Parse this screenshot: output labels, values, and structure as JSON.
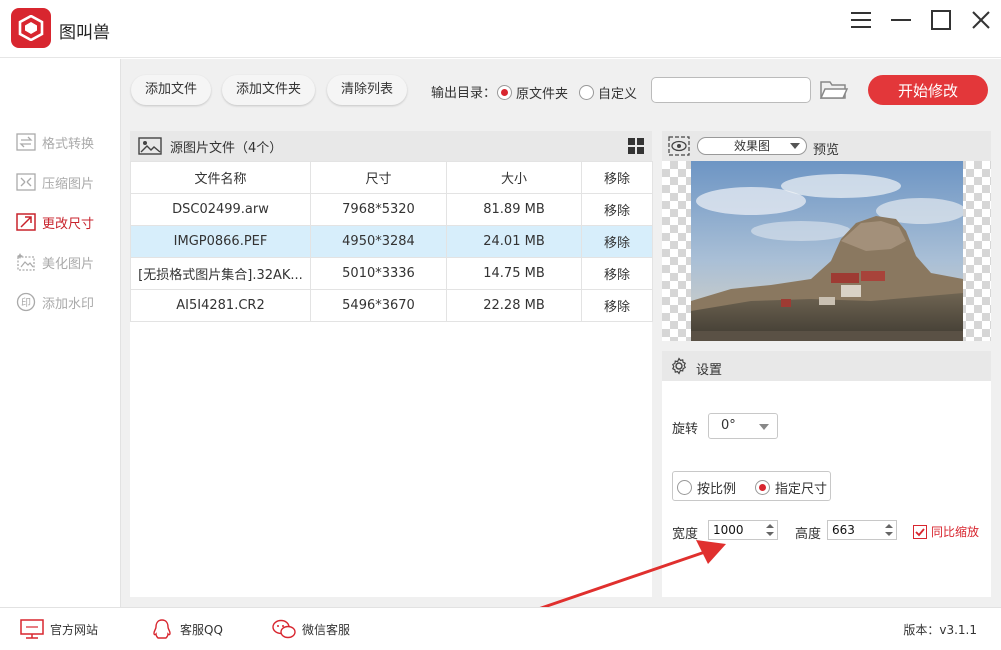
{
  "app": {
    "title": "图叫兽"
  },
  "sidebar": {
    "items": [
      {
        "label": "格式转换",
        "icon": "swap-icon",
        "active": false
      },
      {
        "label": "压缩图片",
        "icon": "compress-icon",
        "active": false
      },
      {
        "label": "更改尺寸",
        "icon": "resize-icon",
        "active": true
      },
      {
        "label": "美化图片",
        "icon": "beautify-icon",
        "active": false
      },
      {
        "label": "添加水印",
        "icon": "watermark-icon",
        "active": false
      }
    ]
  },
  "toolbar": {
    "add_file": "添加文件",
    "add_folder": "添加文件夹",
    "clear_list": "清除列表",
    "output_label": "输出目录：",
    "opt_original": "原文件夹",
    "opt_custom": "自定义",
    "path_value": "",
    "start": "开始修改"
  },
  "files": {
    "header": "源图片文件（4个）",
    "columns": [
      "文件名称",
      "尺寸",
      "大小",
      "移除"
    ],
    "rows": [
      {
        "name": "DSC02499.arw",
        "size": "7968*5320",
        "filesize": "81.89 MB",
        "remove": "移除",
        "selected": false
      },
      {
        "name": "IMGP0866.PEF",
        "size": "4950*3284",
        "filesize": "24.01 MB",
        "remove": "移除",
        "selected": true
      },
      {
        "name": "[无损格式图片集合].32AK...",
        "size": "5010*3336",
        "filesize": "14.75 MB",
        "remove": "移除",
        "selected": false
      },
      {
        "name": "AI5I4281.CR2",
        "size": "5496*3670",
        "filesize": "22.28 MB",
        "remove": "移除",
        "selected": false
      }
    ]
  },
  "preview": {
    "mode": "效果图",
    "label": "预览"
  },
  "settings": {
    "title": "设置",
    "rotate_label": "旋转",
    "rotate_value": "0°",
    "mode_ratio": "按比例",
    "mode_size": "指定尺寸",
    "width_label": "宽度",
    "width_value": "1000",
    "height_label": "高度",
    "height_value": "663",
    "keep_ratio": "同比缩放"
  },
  "status": {
    "website": "官方网站",
    "qq": "客服QQ",
    "wechat": "微信客服",
    "version": "版本：v3.1.1"
  },
  "colors": {
    "accent": "#d8262f",
    "selected_row": "#d7eefb",
    "panel_bg": "#f0f0f0"
  }
}
